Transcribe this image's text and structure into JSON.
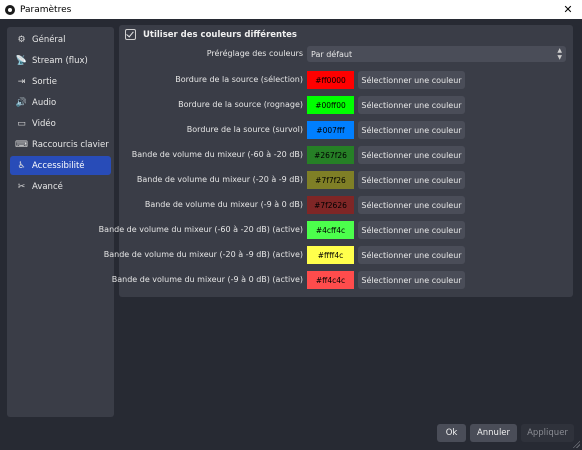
{
  "window": {
    "title": "Paramètres",
    "close_glyph": "✕"
  },
  "sidebar": {
    "items": [
      {
        "label": "Général",
        "icon": "gear-icon",
        "glyph": "⚙",
        "active": false
      },
      {
        "label": "Stream (flux)",
        "icon": "broadcast-icon",
        "glyph": "📡",
        "active": false
      },
      {
        "label": "Sortie",
        "icon": "output-icon",
        "glyph": "⇥",
        "active": false
      },
      {
        "label": "Audio",
        "icon": "speaker-icon",
        "glyph": "🔊",
        "active": false
      },
      {
        "label": "Vidéo",
        "icon": "monitor-icon",
        "glyph": "▭",
        "active": false
      },
      {
        "label": "Raccourcis clavier",
        "icon": "keyboard-icon",
        "glyph": "⌨",
        "active": false
      },
      {
        "label": "Accessibilité",
        "icon": "accessibility-icon",
        "glyph": "♿",
        "active": true
      },
      {
        "label": "Avancé",
        "icon": "tools-icon",
        "glyph": "✂",
        "active": false
      }
    ]
  },
  "content": {
    "use_custom_colors_label": "Utiliser des couleurs différentes",
    "use_custom_colors_checked": true,
    "preset": {
      "label": "Préréglage des couleurs",
      "value": "Par défaut"
    },
    "button_label": "Sélectionner une couleur",
    "colors": [
      {
        "label": "Bordure de la source (sélection)",
        "hex": "#ff0000"
      },
      {
        "label": "Bordure de la source (rognage)",
        "hex": "#00ff00"
      },
      {
        "label": "Bordure de la source (survol)",
        "hex": "#007fff"
      },
      {
        "label": "Bande de volume du mixeur (-60 à -20 dB)",
        "hex": "#267f26"
      },
      {
        "label": "Bande de volume du mixeur (-20 à -9 dB)",
        "hex": "#7f7f26"
      },
      {
        "label": "Bande de volume du mixeur (-9 à 0 dB)",
        "hex": "#7f2626"
      },
      {
        "label": "Bande de volume du mixeur (-60 à -20 dB) (active)",
        "hex": "#4cff4c"
      },
      {
        "label": "Bande de volume du mixeur (-20 à -9 dB) (active)",
        "hex": "#ffff4c"
      },
      {
        "label": "Bande de volume du mixeur (-9 à 0 dB) (active)",
        "hex": "#ff4c4c"
      }
    ]
  },
  "footer": {
    "ok": "Ok",
    "cancel": "Annuler",
    "apply": "Appliquer"
  }
}
